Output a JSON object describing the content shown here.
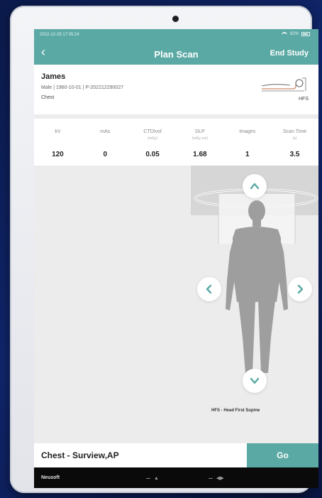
{
  "status": {
    "time": "2022-12-29 17:05:24",
    "battery": "82%"
  },
  "nav": {
    "title": "Plan Scan",
    "end_label": "End Study"
  },
  "patient": {
    "name": "James",
    "meta": "Male  |  1960-10-01  |  P-202212290027",
    "body_part": "Chest",
    "position": "HFS"
  },
  "params": [
    {
      "label": "kV",
      "unit": "",
      "value": "120"
    },
    {
      "label": "mAs",
      "unit": "",
      "value": "0"
    },
    {
      "label": "CTDIvol",
      "unit": "(mGy)",
      "value": "0.05"
    },
    {
      "label": "DLP",
      "unit": "(mGy·cm)",
      "value": "1.68"
    },
    {
      "label": "Images",
      "unit": "",
      "value": "1"
    },
    {
      "label": "Scan Time",
      "unit": "(s)",
      "value": "3.5"
    }
  ],
  "viewer": {
    "position_label": "HFS - Head First Supine"
  },
  "protocol": {
    "name": "Chest - Surview,AP",
    "go_label": "Go"
  },
  "footer": {
    "brand": "Neusoft",
    "control1": "--",
    "control2": "--"
  },
  "colors": {
    "accent": "#5aa9a4",
    "footer": "#0a0a0a"
  }
}
